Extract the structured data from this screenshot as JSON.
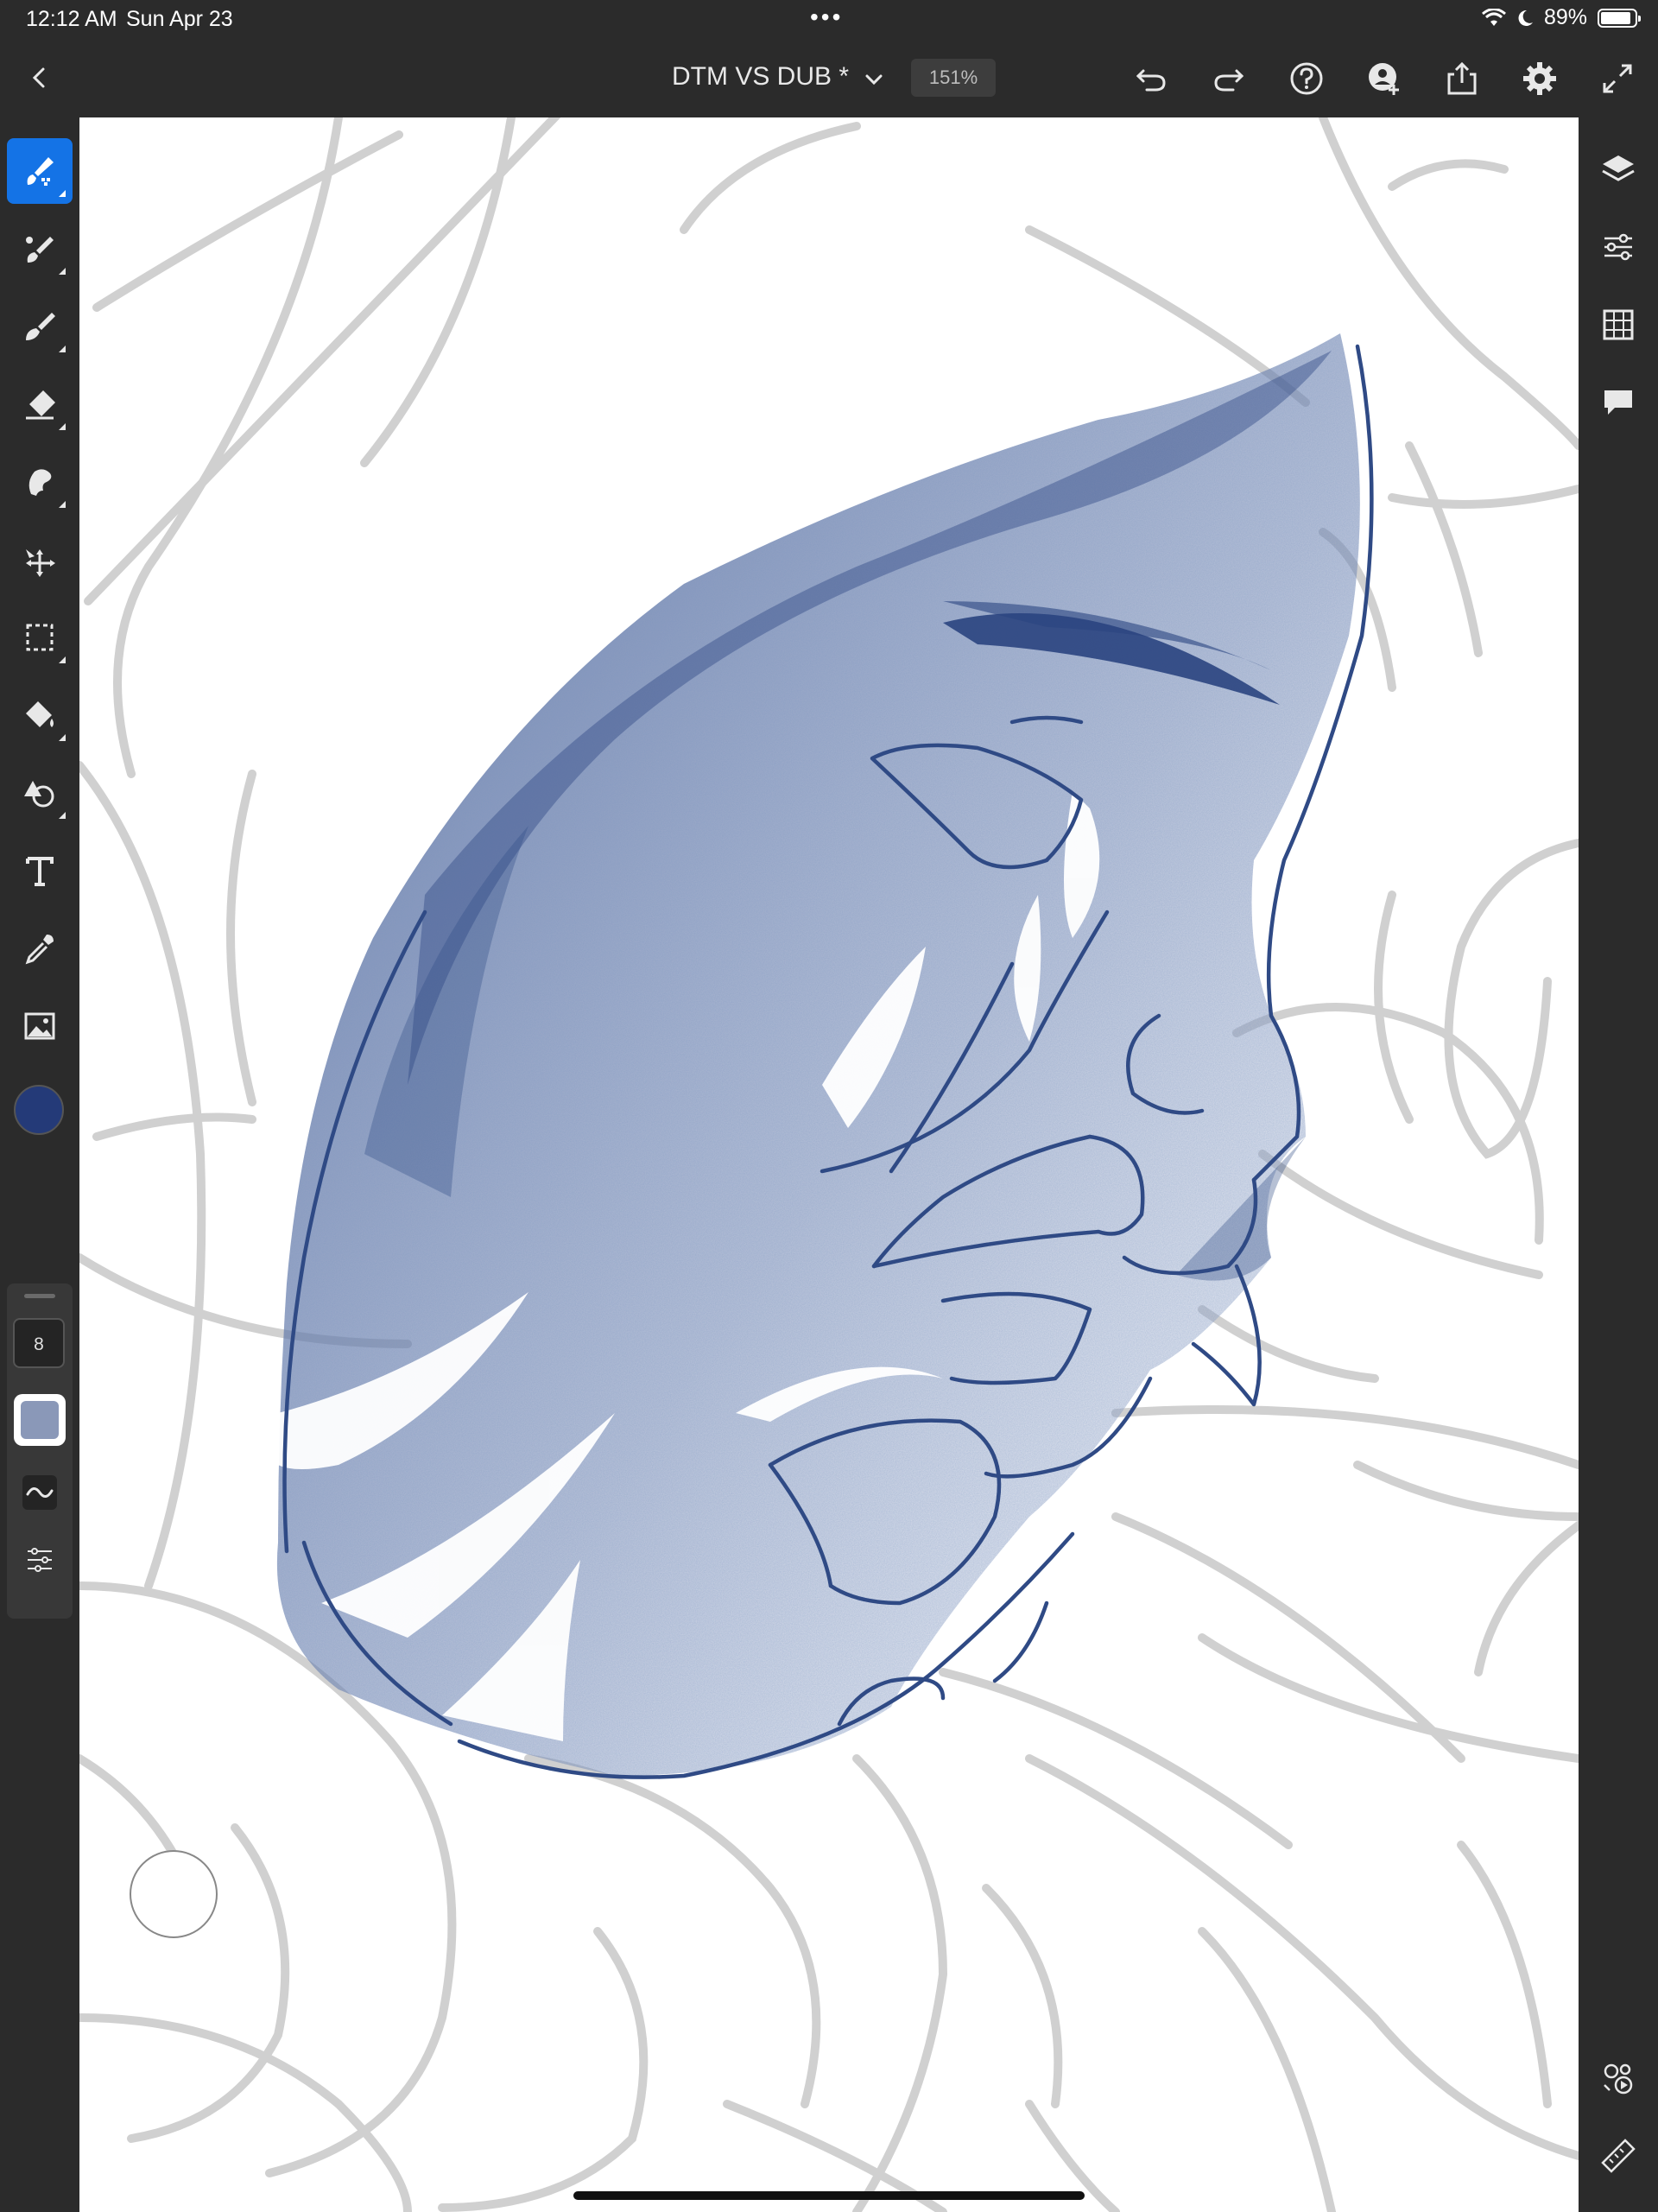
{
  "status_bar": {
    "time": "12:12 AM",
    "date": "Sun Apr 23",
    "multitask_dots": "•••",
    "battery_percent": "89%",
    "battery_level": 0.89
  },
  "toolbar": {
    "document_title": "DTM VS DUB *",
    "zoom_level": "151%",
    "icons": [
      "back-icon",
      "chevron-down-icon",
      "undo-icon",
      "redo-icon",
      "help-icon",
      "invite-icon",
      "share-icon",
      "settings-icon",
      "fullscreen-icon"
    ]
  },
  "left_tools": {
    "items": [
      "pixel-brush-icon",
      "live-brush-icon",
      "vector-brush-icon",
      "eraser-icon",
      "smudge-icon",
      "transform-icon",
      "selection-icon",
      "fill-icon",
      "shape-icon",
      "text-icon",
      "eyedropper-icon",
      "image-icon"
    ],
    "active": "pixel-brush-icon",
    "color": "#243a78",
    "brush_size": "8",
    "brush_opacity_color": "#8a98b8"
  },
  "right_tools": {
    "items": [
      "layers-icon",
      "adjustments-icon",
      "grid-icon",
      "comments-icon",
      "livestream-icon",
      "ruler-icon"
    ]
  },
  "canvas": {
    "background": "#ffffff",
    "sketch_color": "#cfcfcf",
    "ink_color": "#2f4a85"
  }
}
